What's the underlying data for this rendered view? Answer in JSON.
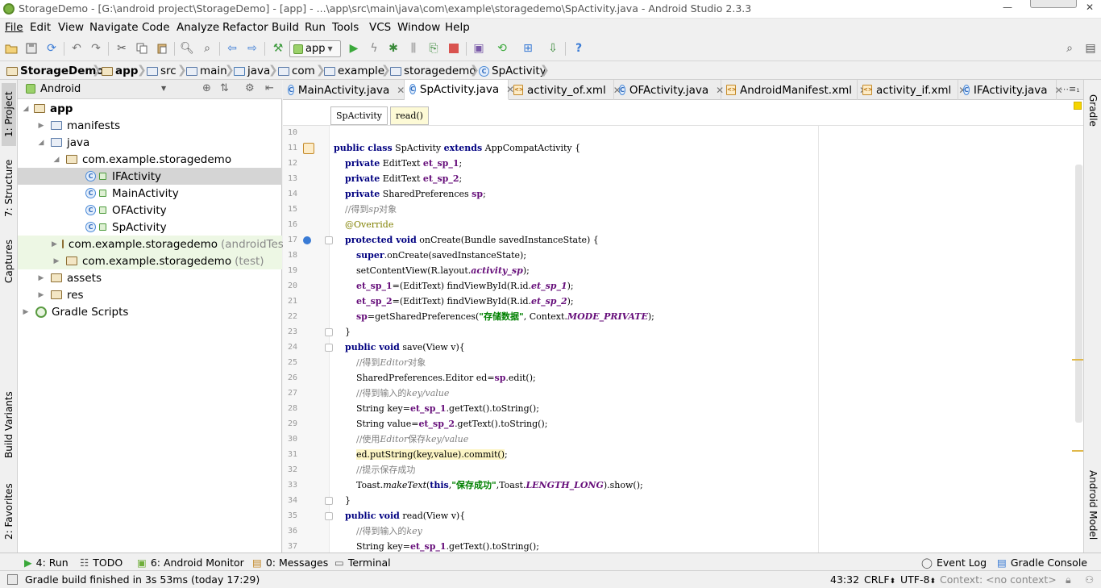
{
  "window": {
    "title": "StorageDemo - [G:\\android project\\StorageDemo] - [app] - ...\\app\\src\\main\\java\\com\\example\\storagedemo\\SpActivity.java - Android Studio 2.3.3",
    "minimize": "—",
    "close": "✕"
  },
  "menu": [
    "File",
    "Edit",
    "View",
    "Navigate",
    "Code",
    "Analyze",
    "Refactor",
    "Build",
    "Run",
    "Tools",
    "VCS",
    "Window",
    "Help"
  ],
  "toolbar": {
    "run_config": "app"
  },
  "breadcrumb": [
    "StorageDemo",
    "app",
    "src",
    "main",
    "java",
    "com",
    "example",
    "storagedemo",
    "SpActivity"
  ],
  "left_stripe": {
    "project": "1: Project",
    "structure": "7: Structure",
    "captures": "Captures",
    "build_variants": "Build Variants",
    "favorites": "2: Favorites"
  },
  "project_panel": {
    "view_mode": "Android",
    "tree": [
      {
        "label": "app",
        "extra": ""
      },
      {
        "label": "manifests",
        "extra": ""
      },
      {
        "label": "java",
        "extra": ""
      },
      {
        "label": "com.example.storagedemo",
        "extra": ""
      },
      {
        "label": "IFActivity",
        "extra": ""
      },
      {
        "label": "MainActivity",
        "extra": ""
      },
      {
        "label": "OFActivity",
        "extra": ""
      },
      {
        "label": "SpActivity",
        "extra": ""
      },
      {
        "label": "com.example.storagedemo",
        "extra": "(androidTest)"
      },
      {
        "label": "com.example.storagedemo",
        "extra": "(test)"
      },
      {
        "label": "assets",
        "extra": ""
      },
      {
        "label": "res",
        "extra": ""
      },
      {
        "label": "Gradle Scripts",
        "extra": ""
      }
    ]
  },
  "tabs": [
    {
      "label": "MainActivity.java",
      "icon": "class-icon"
    },
    {
      "label": "SpActivity.java",
      "icon": "class-icon"
    },
    {
      "label": "activity_of.xml",
      "icon": "xml-icon"
    },
    {
      "label": "OFActivity.java",
      "icon": "class-icon"
    },
    {
      "label": "AndroidManifest.xml",
      "icon": "xml-icon"
    },
    {
      "label": "activity_if.xml",
      "icon": "xml-icon"
    },
    {
      "label": "IFActivity.java",
      "icon": "class-icon"
    }
  ],
  "tab_overflow": "⋯≡₁",
  "editor_crumbs": [
    "SpActivity",
    "read()"
  ],
  "line_numbers": [
    "10",
    "11",
    "12",
    "13",
    "14",
    "15",
    "16",
    "17",
    "18",
    "19",
    "20",
    "21",
    "22",
    "23",
    "24",
    "25",
    "26",
    "27",
    "28",
    "29",
    "30",
    "31",
    "32",
    "33",
    "34",
    "35",
    "36",
    "37"
  ],
  "right_stripe": {
    "gradle": "Gradle",
    "android_model": "Android Model"
  },
  "bottom_tools": [
    "4: Run",
    "TODO",
    "6: Android Monitor",
    "0: Messages",
    "Terminal",
    "Event Log",
    "Gradle Console"
  ],
  "status": {
    "message": "Gradle build finished in 3s 53ms (today 17:29)",
    "position": "43:32",
    "line_sep": "CRLF",
    "encoding": "UTF-8",
    "context": "Context: <no context>"
  },
  "colors": {
    "keyword": "#000080",
    "field": "#660e7a",
    "comment": "#808080",
    "annotation": "#808000",
    "string": "#008000"
  }
}
